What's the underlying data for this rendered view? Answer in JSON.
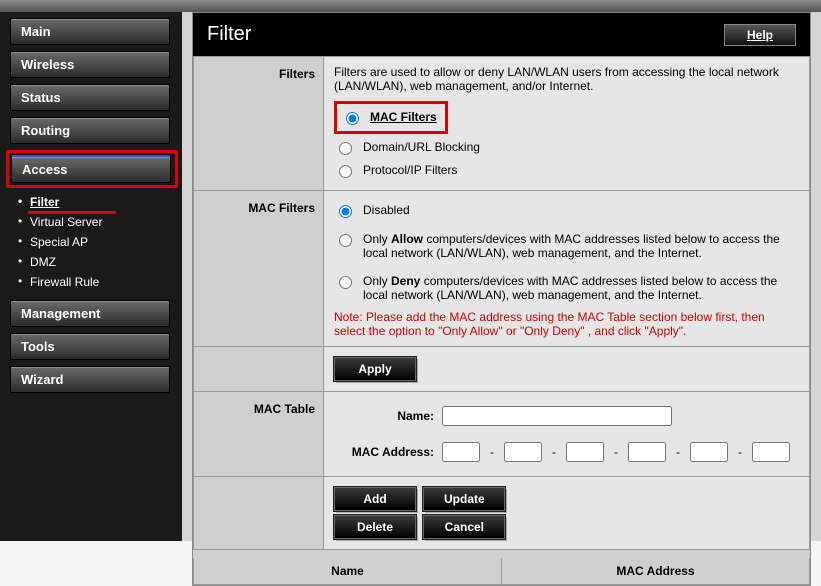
{
  "nav": {
    "main": "Main",
    "wireless": "Wireless",
    "status": "Status",
    "routing": "Routing",
    "access": "Access",
    "management": "Management",
    "tools": "Tools",
    "wizard": "Wizard",
    "sub": {
      "filter": "Filter",
      "virtual_server": "Virtual Server",
      "special_ap": "Special AP",
      "dmz": "DMZ",
      "firewall_rule": "Firewall Rule"
    }
  },
  "header": {
    "title": "Filter",
    "help": "Help"
  },
  "filters": {
    "label": "Filters",
    "desc": "Filters are used to allow or deny LAN/WLAN users from accessing the local network (LAN/WLAN), web management, and/or Internet.",
    "opt_mac": "MAC Filters",
    "opt_domain": "Domain/URL Blocking",
    "opt_protocol": "Protocol/IP Filters"
  },
  "macfilters": {
    "label": "MAC Filters",
    "opt_disabled": "Disabled",
    "opt_allow_pre": "Only ",
    "opt_allow_bold": "Allow",
    "opt_allow_post": " computers/devices with MAC addresses listed below to access the local network (LAN/WLAN), web management, and the Internet.",
    "opt_deny_pre": "Only ",
    "opt_deny_bold": "Deny",
    "opt_deny_post": " computers/devices with MAC addresses listed below to access the local network (LAN/WLAN), web management, and the Internet.",
    "note": "Note: Please add the MAC address using the MAC Table section below first, then select the option to \"Only Allow\" or \"Only Deny\" , and click \"Apply\".",
    "apply": "Apply"
  },
  "mactable": {
    "label": "MAC Table",
    "name_lbl": "Name:",
    "mac_lbl": "MAC Address:",
    "add": "Add",
    "update": "Update",
    "delete": "Delete",
    "cancel": "Cancel"
  },
  "list": {
    "col_name": "Name",
    "col_mac": "MAC Address"
  }
}
